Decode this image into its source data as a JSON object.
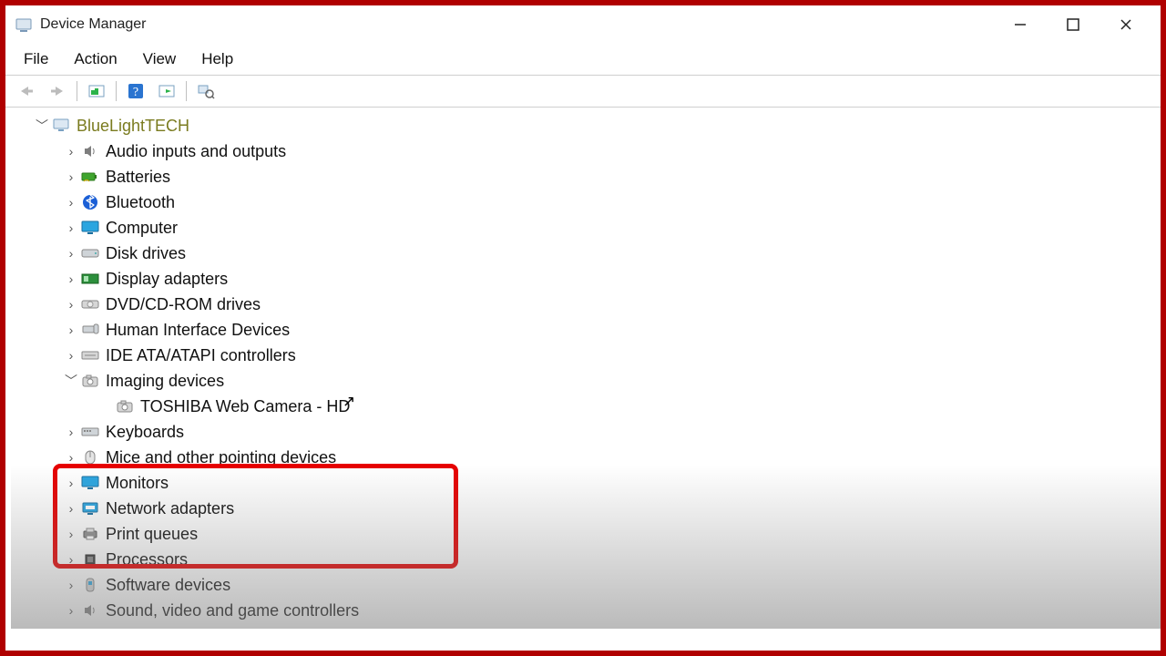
{
  "window": {
    "title": "Device Manager"
  },
  "menu": {
    "file": "File",
    "action": "Action",
    "view": "View",
    "help": "Help"
  },
  "tree": {
    "root": "BlueLightTECH",
    "items": [
      {
        "label": "Audio inputs and outputs",
        "icon": "speaker",
        "state": "closed"
      },
      {
        "label": "Batteries",
        "icon": "battery",
        "state": "closed"
      },
      {
        "label": "Bluetooth",
        "icon": "bluetooth",
        "state": "closed"
      },
      {
        "label": "Computer",
        "icon": "monitor",
        "state": "closed"
      },
      {
        "label": "Disk drives",
        "icon": "disk",
        "state": "closed"
      },
      {
        "label": "Display adapters",
        "icon": "gpu",
        "state": "closed"
      },
      {
        "label": "DVD/CD-ROM drives",
        "icon": "optical",
        "state": "closed"
      },
      {
        "label": "Human Interface Devices",
        "icon": "hid",
        "state": "closed"
      },
      {
        "label": "IDE ATA/ATAPI controllers",
        "icon": "ide",
        "state": "closed"
      },
      {
        "label": "Imaging devices",
        "icon": "camera",
        "state": "open",
        "children": [
          {
            "label": "TOSHIBA Web Camera - HD",
            "icon": "camera"
          }
        ]
      },
      {
        "label": "Keyboards",
        "icon": "keyboard",
        "state": "closed"
      },
      {
        "label": "Mice and other pointing devices",
        "icon": "mouse",
        "state": "closed"
      },
      {
        "label": "Monitors",
        "icon": "monitor2",
        "state": "closed"
      },
      {
        "label": "Network adapters",
        "icon": "network",
        "state": "closed"
      },
      {
        "label": "Print queues",
        "icon": "printer",
        "state": "closed"
      },
      {
        "label": "Processors",
        "icon": "cpu",
        "state": "closed"
      },
      {
        "label": "Software devices",
        "icon": "software",
        "state": "closed"
      },
      {
        "label": "Sound, video and game controllers",
        "icon": "speaker2",
        "state": "closed"
      }
    ]
  }
}
